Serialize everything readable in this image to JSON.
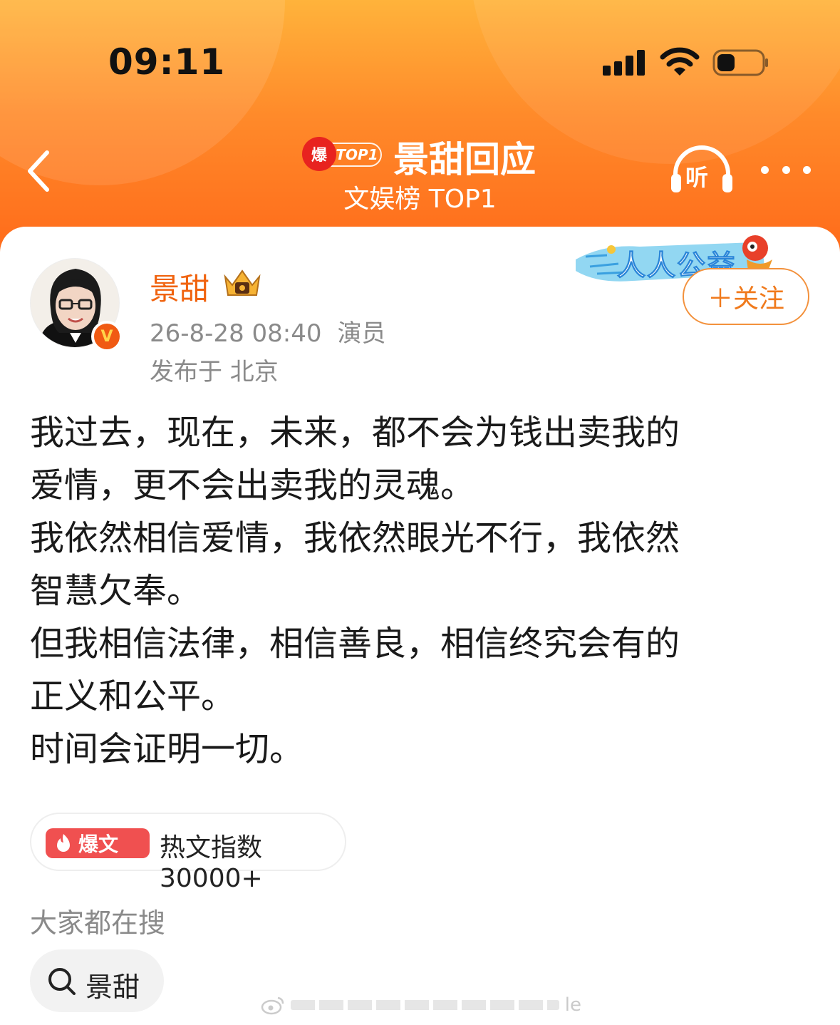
{
  "status_bar": {
    "time": "09:11"
  },
  "header": {
    "badge_flame": "爆",
    "badge_rank": "TOP1",
    "title": "景甜回应",
    "subtitle": "文娱榜 TOP1",
    "listen_label": "听"
  },
  "post": {
    "author": "景甜",
    "verified_mark": "V",
    "date": "26-8-28 08:40",
    "role": "演员",
    "location": "发布于 北京",
    "banner_text": "人人公益",
    "follow_label": "＋关注",
    "lines": [
      "我过去，现在，未来，都不会为钱出卖我的",
      "爱情，更不会出卖我的灵魂。",
      "我依然相信爱情，我依然眼光不行，我依然",
      "智慧欠奉。",
      "但我相信法律，相信善良，相信终究会有的",
      "正义和公平。",
      "时间会证明一切。"
    ]
  },
  "hot": {
    "tag": "爆文",
    "label": "热文指数30000+"
  },
  "search": {
    "title": "大家都在搜",
    "chip": "景甜"
  },
  "watermark": {
    "text": "le"
  },
  "colors": {
    "accent": "#f0630f",
    "header_top": "#ffb33b",
    "header_bottom": "#ff6a1a"
  }
}
